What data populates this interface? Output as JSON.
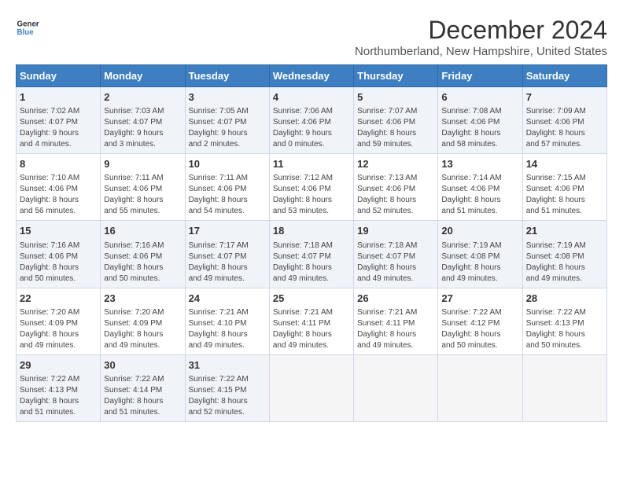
{
  "header": {
    "logo_line1": "General",
    "logo_line2": "Blue",
    "month": "December 2024",
    "location": "Northumberland, New Hampshire, United States"
  },
  "weekdays": [
    "Sunday",
    "Monday",
    "Tuesday",
    "Wednesday",
    "Thursday",
    "Friday",
    "Saturday"
  ],
  "weeks": [
    [
      {
        "day": "1",
        "info": "Sunrise: 7:02 AM\nSunset: 4:07 PM\nDaylight: 9 hours\nand 4 minutes."
      },
      {
        "day": "2",
        "info": "Sunrise: 7:03 AM\nSunset: 4:07 PM\nDaylight: 9 hours\nand 3 minutes."
      },
      {
        "day": "3",
        "info": "Sunrise: 7:05 AM\nSunset: 4:07 PM\nDaylight: 9 hours\nand 2 minutes."
      },
      {
        "day": "4",
        "info": "Sunrise: 7:06 AM\nSunset: 4:06 PM\nDaylight: 9 hours\nand 0 minutes."
      },
      {
        "day": "5",
        "info": "Sunrise: 7:07 AM\nSunset: 4:06 PM\nDaylight: 8 hours\nand 59 minutes."
      },
      {
        "day": "6",
        "info": "Sunrise: 7:08 AM\nSunset: 4:06 PM\nDaylight: 8 hours\nand 58 minutes."
      },
      {
        "day": "7",
        "info": "Sunrise: 7:09 AM\nSunset: 4:06 PM\nDaylight: 8 hours\nand 57 minutes."
      }
    ],
    [
      {
        "day": "8",
        "info": "Sunrise: 7:10 AM\nSunset: 4:06 PM\nDaylight: 8 hours\nand 56 minutes."
      },
      {
        "day": "9",
        "info": "Sunrise: 7:11 AM\nSunset: 4:06 PM\nDaylight: 8 hours\nand 55 minutes."
      },
      {
        "day": "10",
        "info": "Sunrise: 7:11 AM\nSunset: 4:06 PM\nDaylight: 8 hours\nand 54 minutes."
      },
      {
        "day": "11",
        "info": "Sunrise: 7:12 AM\nSunset: 4:06 PM\nDaylight: 8 hours\nand 53 minutes."
      },
      {
        "day": "12",
        "info": "Sunrise: 7:13 AM\nSunset: 4:06 PM\nDaylight: 8 hours\nand 52 minutes."
      },
      {
        "day": "13",
        "info": "Sunrise: 7:14 AM\nSunset: 4:06 PM\nDaylight: 8 hours\nand 51 minutes."
      },
      {
        "day": "14",
        "info": "Sunrise: 7:15 AM\nSunset: 4:06 PM\nDaylight: 8 hours\nand 51 minutes."
      }
    ],
    [
      {
        "day": "15",
        "info": "Sunrise: 7:16 AM\nSunset: 4:06 PM\nDaylight: 8 hours\nand 50 minutes."
      },
      {
        "day": "16",
        "info": "Sunrise: 7:16 AM\nSunset: 4:06 PM\nDaylight: 8 hours\nand 50 minutes."
      },
      {
        "day": "17",
        "info": "Sunrise: 7:17 AM\nSunset: 4:07 PM\nDaylight: 8 hours\nand 49 minutes."
      },
      {
        "day": "18",
        "info": "Sunrise: 7:18 AM\nSunset: 4:07 PM\nDaylight: 8 hours\nand 49 minutes."
      },
      {
        "day": "19",
        "info": "Sunrise: 7:18 AM\nSunset: 4:07 PM\nDaylight: 8 hours\nand 49 minutes."
      },
      {
        "day": "20",
        "info": "Sunrise: 7:19 AM\nSunset: 4:08 PM\nDaylight: 8 hours\nand 49 minutes."
      },
      {
        "day": "21",
        "info": "Sunrise: 7:19 AM\nSunset: 4:08 PM\nDaylight: 8 hours\nand 49 minutes."
      }
    ],
    [
      {
        "day": "22",
        "info": "Sunrise: 7:20 AM\nSunset: 4:09 PM\nDaylight: 8 hours\nand 49 minutes."
      },
      {
        "day": "23",
        "info": "Sunrise: 7:20 AM\nSunset: 4:09 PM\nDaylight: 8 hours\nand 49 minutes."
      },
      {
        "day": "24",
        "info": "Sunrise: 7:21 AM\nSunset: 4:10 PM\nDaylight: 8 hours\nand 49 minutes."
      },
      {
        "day": "25",
        "info": "Sunrise: 7:21 AM\nSunset: 4:11 PM\nDaylight: 8 hours\nand 49 minutes."
      },
      {
        "day": "26",
        "info": "Sunrise: 7:21 AM\nSunset: 4:11 PM\nDaylight: 8 hours\nand 49 minutes."
      },
      {
        "day": "27",
        "info": "Sunrise: 7:22 AM\nSunset: 4:12 PM\nDaylight: 8 hours\nand 50 minutes."
      },
      {
        "day": "28",
        "info": "Sunrise: 7:22 AM\nSunset: 4:13 PM\nDaylight: 8 hours\nand 50 minutes."
      }
    ],
    [
      {
        "day": "29",
        "info": "Sunrise: 7:22 AM\nSunset: 4:13 PM\nDaylight: 8 hours\nand 51 minutes."
      },
      {
        "day": "30",
        "info": "Sunrise: 7:22 AM\nSunset: 4:14 PM\nDaylight: 8 hours\nand 51 minutes."
      },
      {
        "day": "31",
        "info": "Sunrise: 7:22 AM\nSunset: 4:15 PM\nDaylight: 8 hours\nand 52 minutes."
      },
      {
        "day": "",
        "info": ""
      },
      {
        "day": "",
        "info": ""
      },
      {
        "day": "",
        "info": ""
      },
      {
        "day": "",
        "info": ""
      }
    ]
  ]
}
